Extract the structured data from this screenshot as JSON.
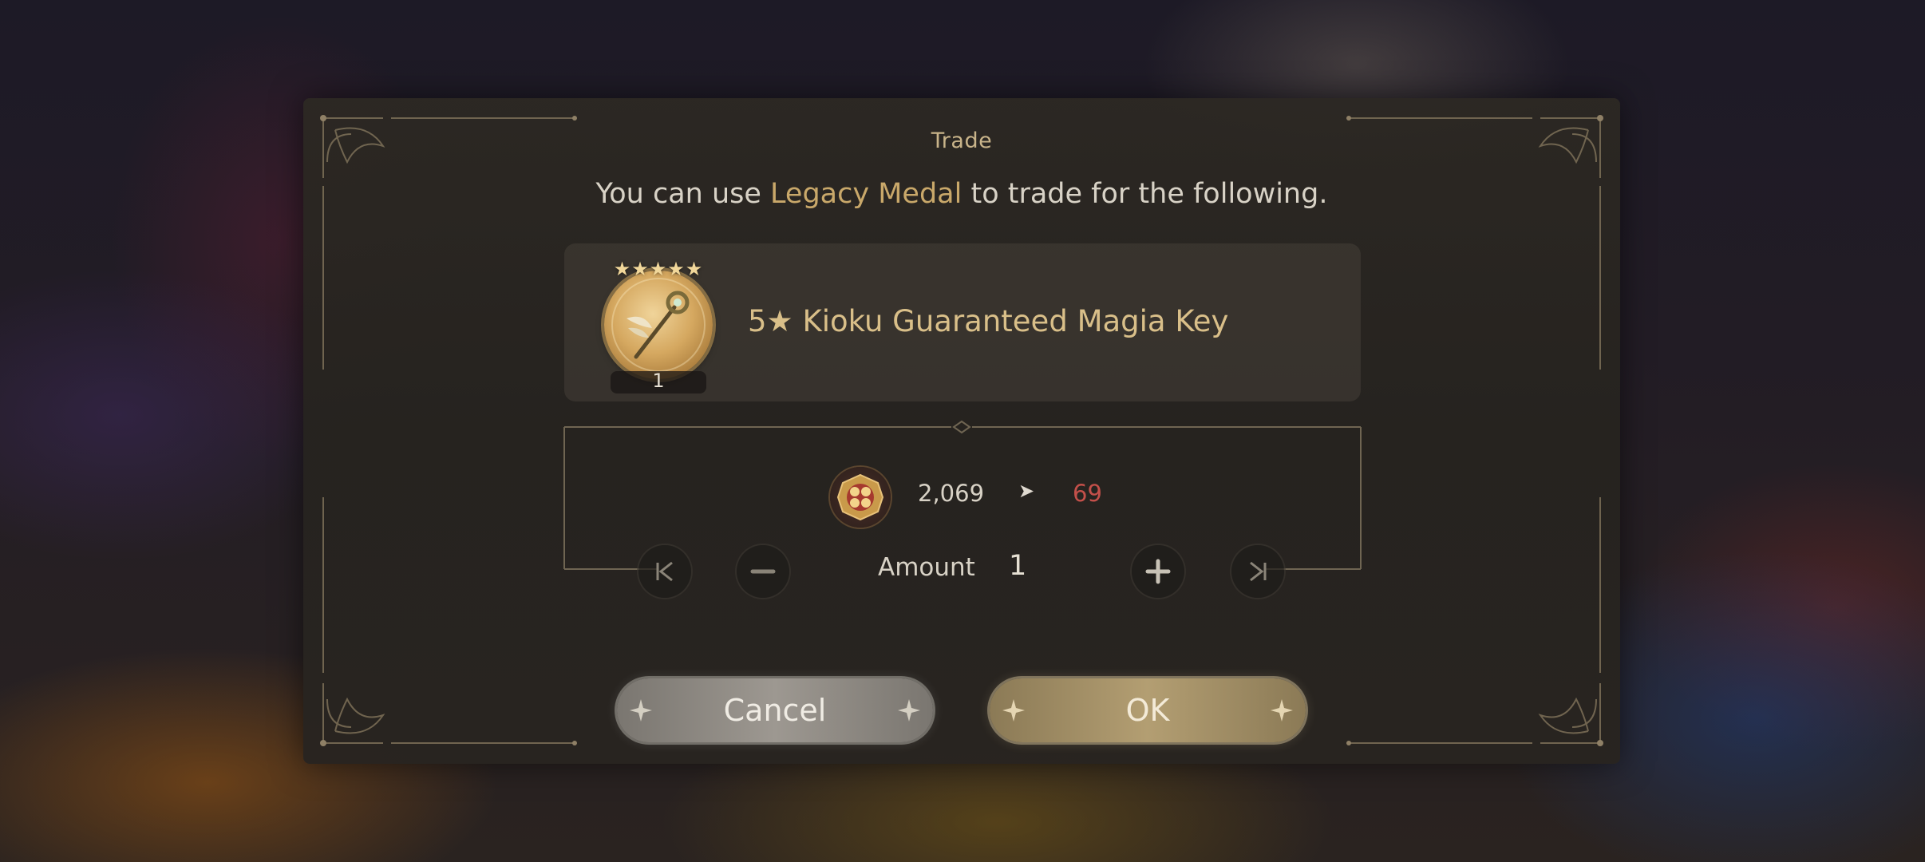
{
  "dialog": {
    "title": "Trade",
    "subtitle_pre": "You can use ",
    "subtitle_highlight": "Legacy Medal",
    "subtitle_post": " to trade for the following."
  },
  "item": {
    "stars": "★★★★★",
    "name": "5★ Kioku Guaranteed Magia Key",
    "count": "1",
    "icon": "magia-key-icon"
  },
  "exchange": {
    "currency_icon": "legacy-medal-icon",
    "current": "2,069",
    "arrow": "➤",
    "after": "69"
  },
  "amount": {
    "label": "Amount",
    "value": "1"
  },
  "buttons": {
    "cancel": "Cancel",
    "ok": "OK"
  },
  "colors": {
    "accent_gold": "#c9a86a",
    "after_value_red": "#c4504a"
  }
}
